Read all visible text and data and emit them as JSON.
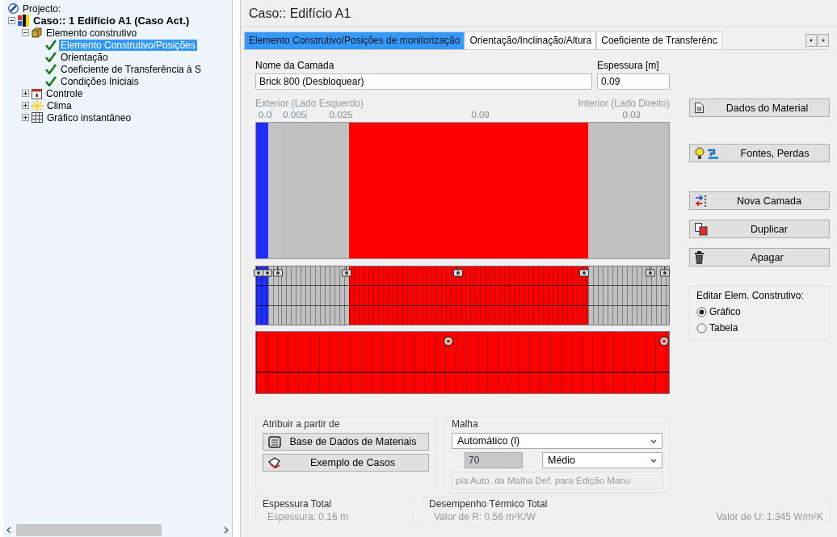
{
  "tree": {
    "root": {
      "label": "Projecto:"
    },
    "items": [
      {
        "label": "Caso:: 1 Edifício A1 (Caso Act.)",
        "kind": "case",
        "expanded": true,
        "selected": false,
        "children": [
          {
            "label": "Elemento construtivo",
            "kind": "element",
            "expanded": true,
            "selected": false,
            "children": [
              {
                "label": "Elemento Construtivo/Posições",
                "kind": "check",
                "selected": true
              },
              {
                "label": "Orientação",
                "kind": "check",
                "selected": false
              },
              {
                "label": "Coeficiente de Transferência à S",
                "kind": "check",
                "selected": false
              },
              {
                "label": "Condições Iniciais",
                "kind": "check",
                "selected": false
              }
            ]
          },
          {
            "label": "Controle",
            "kind": "control",
            "expanded": false,
            "selected": false
          },
          {
            "label": "Clima",
            "kind": "climate",
            "expanded": false,
            "selected": false
          },
          {
            "label": "Gráfico instantâneo",
            "kind": "chart",
            "expanded": false,
            "selected": false
          }
        ]
      }
    ]
  },
  "title": "Caso::  Edifício A1",
  "tabs": [
    {
      "label": "Elemento Construtivo/Posições de monitorização",
      "selected": true
    },
    {
      "label": "Orientação/Inclinação/Altura",
      "selected": false
    },
    {
      "label": "Coeficiente de Transferênc",
      "selected": false
    }
  ],
  "layer_name": {
    "label": "Nome da Camada",
    "value": "Brick 800 (Desbloquear)"
  },
  "thickness": {
    "label": "Espessura [m]",
    "value": "0.09"
  },
  "exterior_label": "Exterior (Lado Esquerdo)",
  "interior_label": "Interior (Lado Direito)",
  "layers": [
    {
      "thickness": "0.0",
      "color": "#1f2fff"
    },
    {
      "thickness": "0.005",
      "color": "#c4c4c4"
    },
    {
      "thickness": "0.025",
      "color": "#c0c0c0"
    },
    {
      "thickness": "0.09",
      "color": "#ff0000"
    },
    {
      "thickness": "0.03",
      "color": "#c0c0c0"
    }
  ],
  "side_buttons": [
    {
      "label": "Dados do Material",
      "kind": "document"
    },
    {
      "label": "Fontes, Perdas",
      "kind": "sources"
    },
    {
      "label": "Nova Camada",
      "kind": "new-layer"
    },
    {
      "label": "Duplicar",
      "kind": "duplicate"
    },
    {
      "label": "Apagar",
      "kind": "delete"
    }
  ],
  "edit_mode": {
    "label": "Editar Elem. Construtivo:",
    "options": [
      {
        "label": "Gráfico",
        "selected": true
      },
      {
        "label": "Tabela",
        "selected": false
      }
    ]
  },
  "assign": {
    "label": "Atribuir a partir de",
    "buttons": [
      {
        "label": "Base de Dados de Materiais",
        "kind": "database"
      },
      {
        "label": "Exemplo de Casos",
        "kind": "cases"
      }
    ]
  },
  "mesh": {
    "label": "Malha",
    "mode": "Automático (l)",
    "count": "70",
    "density": "Médio",
    "copy_button": "pia Auto. da Malha Def. para Edição Manu"
  },
  "total_thickness": {
    "label": "Espessura Total",
    "value": "Espessura: 0,16 m"
  },
  "thermal": {
    "label": "Desempenho Térmico Total",
    "r_value": "Valor de R: 0,56 m²K/W",
    "u_value": "Valor de U: 1,345 W/m²K"
  }
}
